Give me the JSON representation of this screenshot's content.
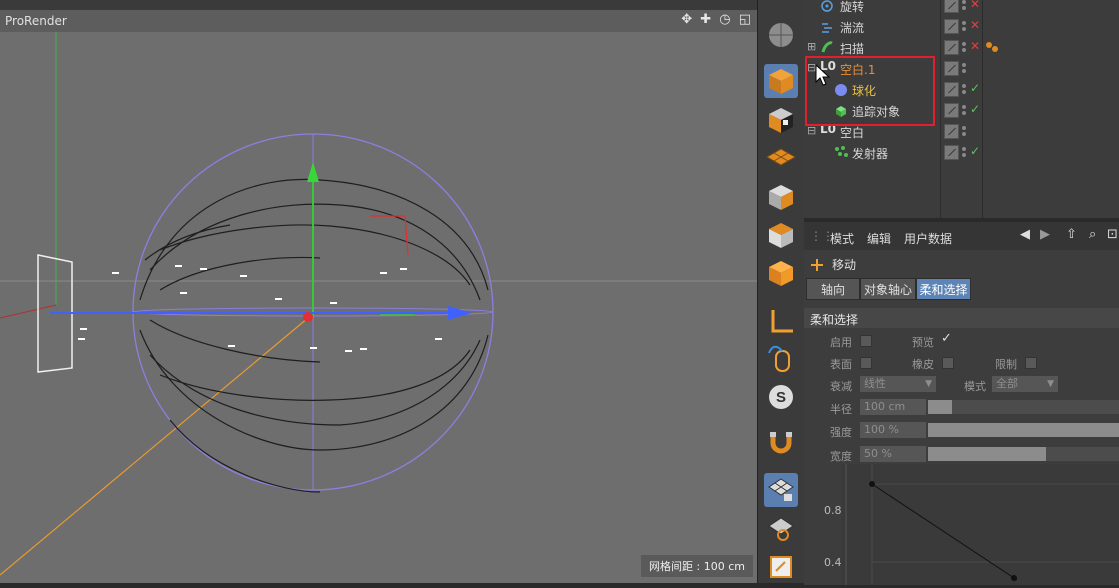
{
  "viewport": {
    "title": "ProRender",
    "nav_icons": "✥ ✚ ◷ ◱",
    "grid_label": "网格间距 : 100 cm"
  },
  "toolbar": {
    "tools": [
      "cube-icon",
      "checker-cube-icon",
      "floor-grid-icon",
      "cube-light-icon",
      "cube-view-icon",
      "orange-cube-icon",
      "axis-l-icon",
      "mouse-icon",
      "s-letter-icon",
      "magnet-icon",
      "grid-lock-icon",
      "grid-rotate-icon",
      "tablet-icon"
    ]
  },
  "object_manager": {
    "rows": [
      {
        "name": "旋转",
        "status": "x"
      },
      {
        "name": "湍流",
        "status": "x"
      },
      {
        "name": "扫描",
        "status": "x"
      },
      {
        "name": "空白.1",
        "status": ""
      },
      {
        "name": "球化",
        "status": "ok"
      },
      {
        "name": "追踪对象",
        "status": "ok"
      },
      {
        "name": "空白",
        "status": ""
      },
      {
        "name": "发射器",
        "status": "ok"
      }
    ]
  },
  "attributes": {
    "menu": [
      "模式",
      "编辑",
      "用户数据"
    ],
    "object_label": "移动",
    "tabs": [
      "轴向",
      "对象轴心",
      "柔和选择"
    ],
    "section": "柔和选择",
    "enable_label": "启用",
    "preview_label": "预览",
    "surface_label": "表面",
    "rubber_label": "橡皮",
    "limit_label": "限制",
    "falloff_label": "衰减",
    "falloff_value": "线性",
    "mode_label": "模式",
    "mode_value": "全部",
    "radius_label": "半径",
    "radius_value": "100 cm",
    "strength_label": "强度",
    "strength_value": "100 %",
    "width_label": "宽度",
    "width_value": "50 %",
    "graph_y_labels": [
      "0.8",
      "0.4"
    ]
  },
  "colors": {
    "accent_blue": "#5d84b6",
    "error_red": "#e04040",
    "ok_green": "#5fc45f",
    "highlight": "#e0202c"
  }
}
